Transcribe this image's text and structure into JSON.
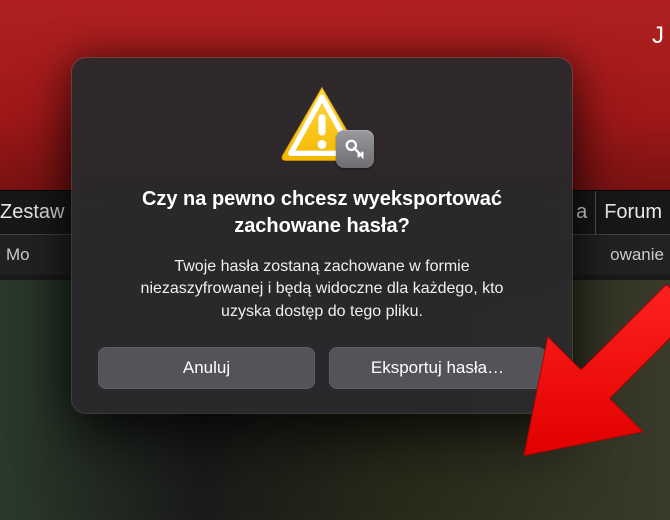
{
  "background": {
    "header_text_fragment": "J",
    "tab_left": "Zestaw",
    "tab_a": "a",
    "tab_forum": "Forum",
    "subtab_left": "Mo",
    "subtab_right": "owanie"
  },
  "dialog": {
    "title": "Czy na pewno chcesz wyeksportować zachowane hasła?",
    "body": "Twoje hasła zostaną zachowane w formie niezaszyfrowanej i będą widoczne dla każdego, kto uzyska dostęp do tego pliku.",
    "cancel_label": "Anuluj",
    "export_label": "Eksportuj hasła…"
  }
}
